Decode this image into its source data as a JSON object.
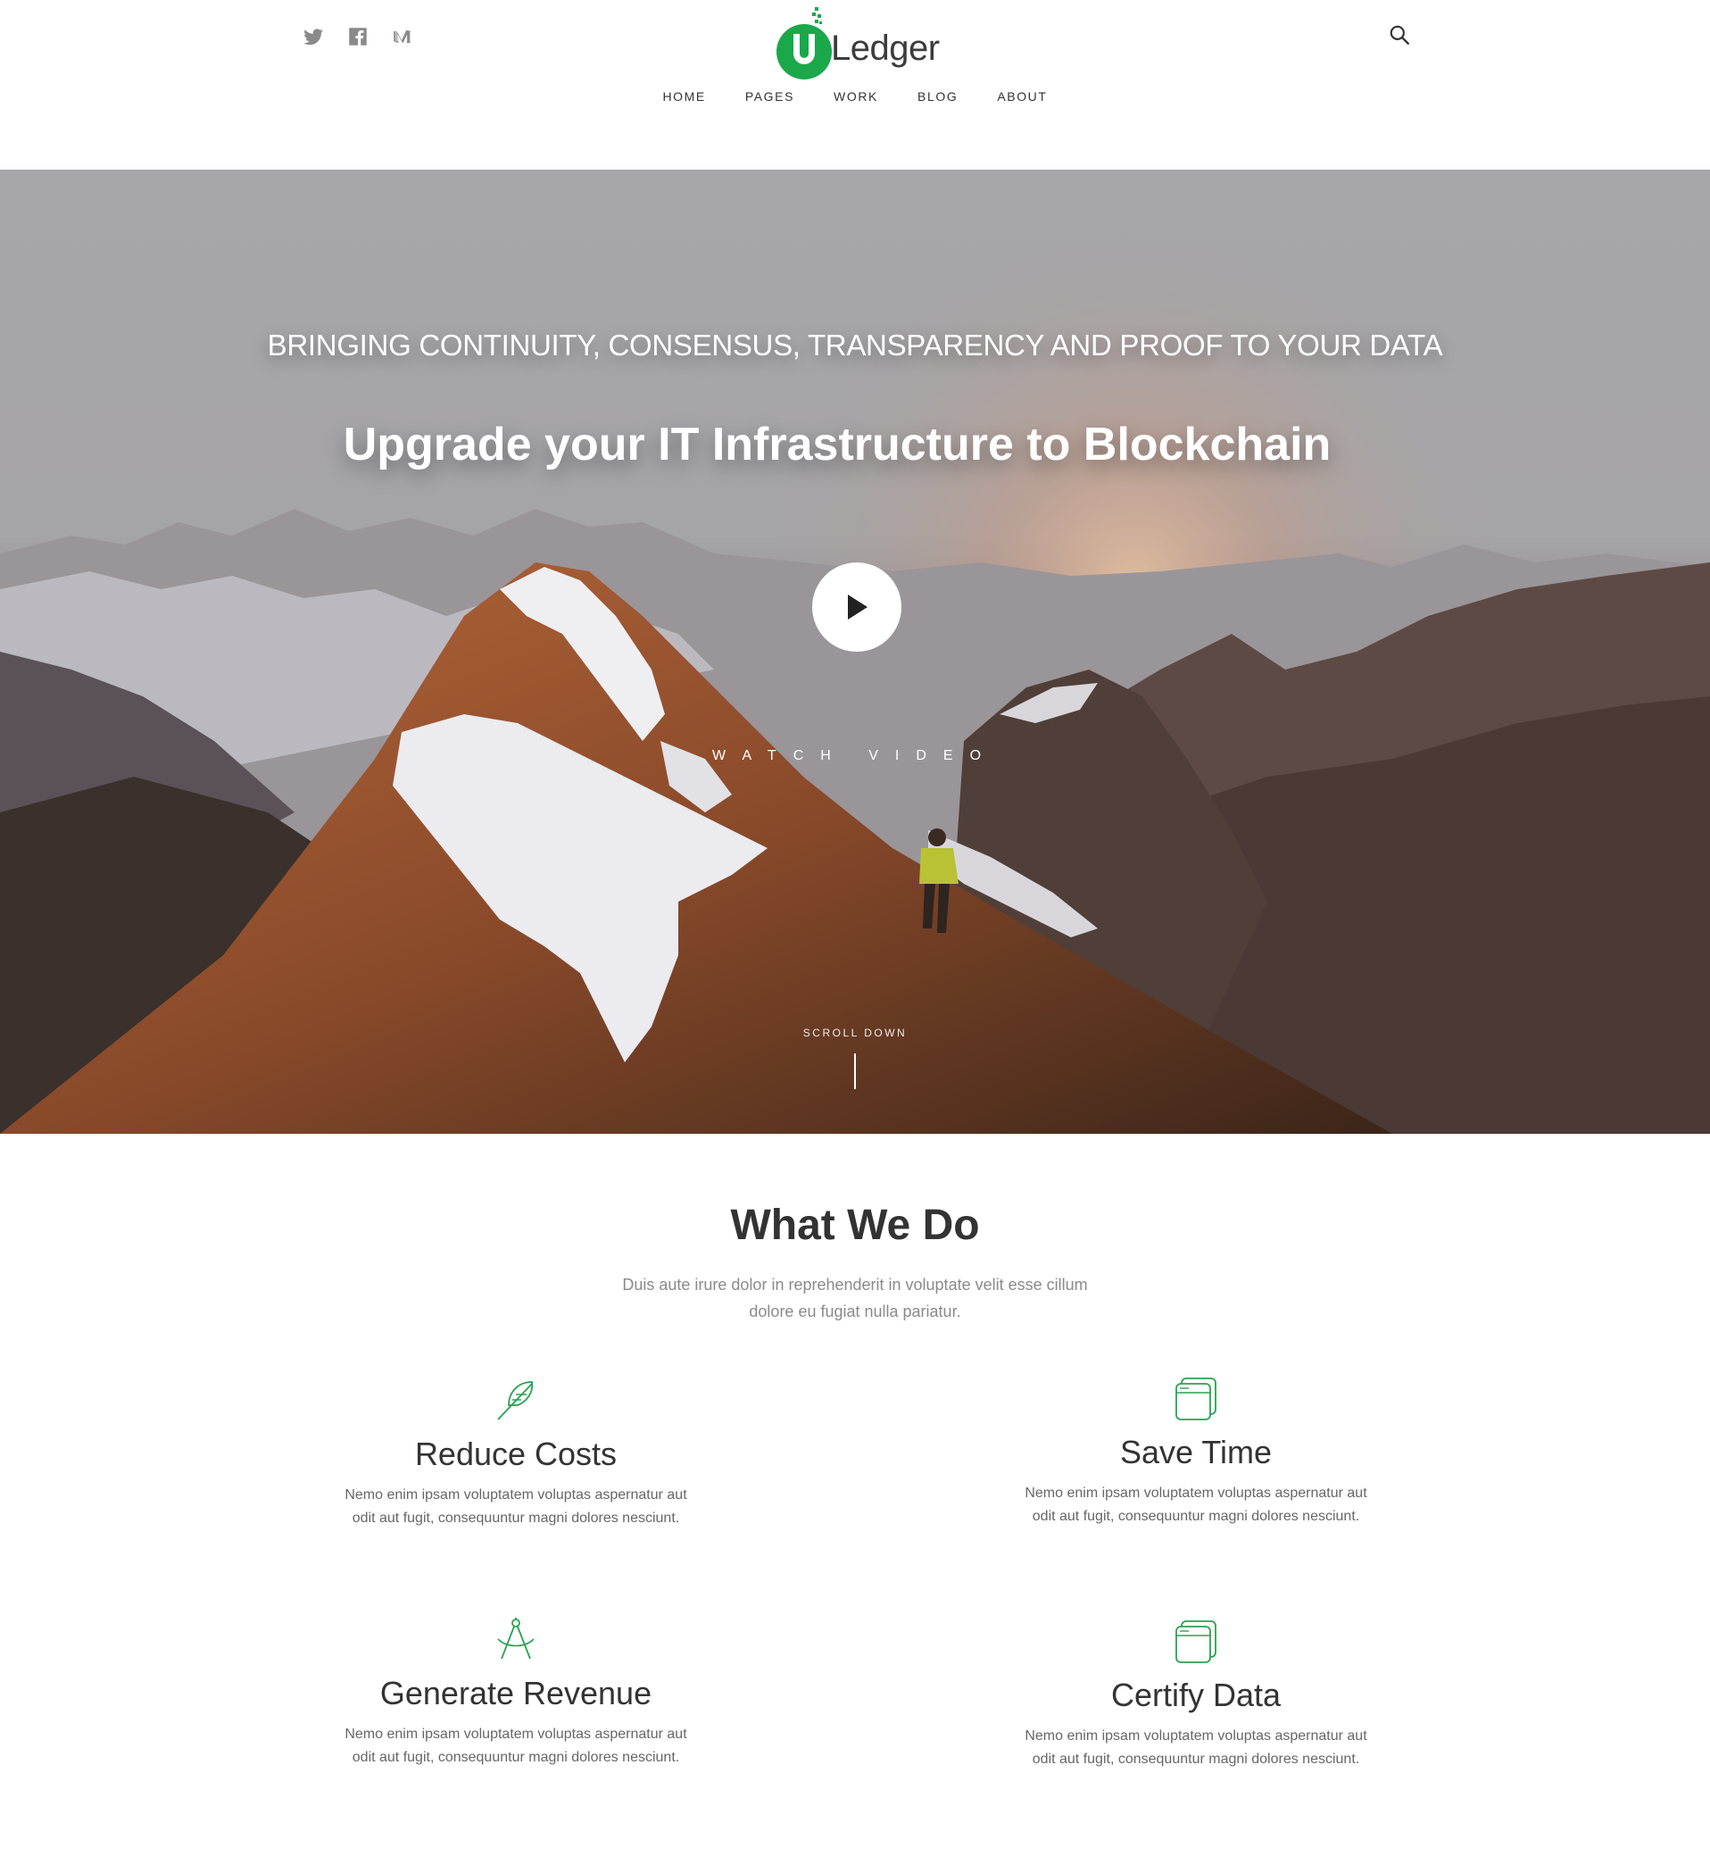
{
  "brand": {
    "logo_text": "Ledger",
    "logo_letter": "U",
    "accent": "#1aa84a"
  },
  "header": {
    "social": [
      {
        "name": "twitter-icon"
      },
      {
        "name": "facebook-icon"
      },
      {
        "name": "medium-icon"
      }
    ],
    "nav": [
      {
        "label": "HOME"
      },
      {
        "label": "PAGES"
      },
      {
        "label": "WORK"
      },
      {
        "label": "BLOG"
      },
      {
        "label": "ABOUT"
      }
    ],
    "search_icon": "search-icon"
  },
  "hero": {
    "eyebrow": "BRINGING CONTINUITY, CONSENSUS, TRANSPARENCY AND PROOF TO YOUR DATA",
    "title": "Upgrade your IT Infrastructure to Blockchain",
    "watch_label": "WATCH VIDEO",
    "scroll_label": "SCROLL DOWN"
  },
  "what_we_do": {
    "title": "What We Do",
    "subtitle": "Duis aute irure dolor in reprehenderit in voluptate velit esse cillum dolore eu fugiat nulla pariatur.",
    "features": [
      {
        "title": "Reduce Costs",
        "text": "Nemo enim ipsam voluptatem voluptas aspernatur aut odit aut fugit, consequuntur magni dolores nesciunt.",
        "icon": "feather-icon"
      },
      {
        "title": "Save Time",
        "text": "Nemo enim ipsam voluptatem voluptas aspernatur aut odit aut fugit, consequuntur magni dolores nesciunt.",
        "icon": "windows-icon"
      },
      {
        "title": "Generate Revenue",
        "text": "Nemo enim ipsam voluptatem voluptas aspernatur aut odit aut fugit, consequuntur magni dolores nesciunt.",
        "icon": "compass-icon"
      },
      {
        "title": "Certify Data",
        "text": "Nemo enim ipsam voluptatem voluptas aspernatur aut odit aut fugit, consequuntur magni dolores nesciunt.",
        "icon": "windows-icon"
      }
    ]
  }
}
